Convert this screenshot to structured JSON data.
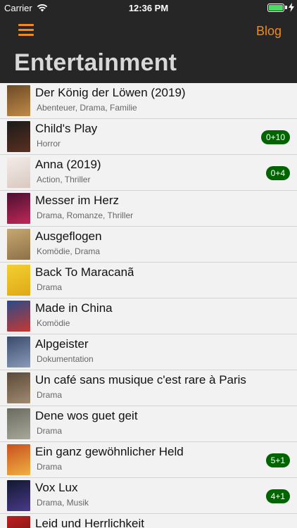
{
  "status": {
    "carrier": "Carrier",
    "time": "12:36 PM"
  },
  "nav": {
    "blog_label": "Blog",
    "title": "Entertainment"
  },
  "movies": [
    {
      "title": "Der König der Löwen (2019)",
      "genres": "Abenteuer, Drama, Familie",
      "badge": "",
      "poster_colors": [
        "#6b4a26",
        "#c08a48"
      ]
    },
    {
      "title": "Child's Play",
      "genres": "Horror",
      "badge": "0+10",
      "poster_colors": [
        "#1a1a1a",
        "#5a3020"
      ]
    },
    {
      "title": "Anna (2019)",
      "genres": "Action, Thriller",
      "badge": "0+4",
      "poster_colors": [
        "#f3ece8",
        "#d9c8c0"
      ]
    },
    {
      "title": "Messer im Herz",
      "genres": "Drama, Romanze, Thriller",
      "badge": "",
      "poster_colors": [
        "#4a1030",
        "#c02858"
      ]
    },
    {
      "title": "Ausgeflogen",
      "genres": "Komödie, Drama",
      "badge": "",
      "poster_colors": [
        "#c8a870",
        "#8c7048"
      ]
    },
    {
      "title": "Back To Maracanã",
      "genres": "Drama",
      "badge": "",
      "poster_colors": [
        "#f2d030",
        "#e0a818"
      ]
    },
    {
      "title": "Made in China",
      "genres": "Komödie",
      "badge": "",
      "poster_colors": [
        "#2a4a8a",
        "#c83830"
      ]
    },
    {
      "title": "Alpgeister",
      "genres": "Dokumentation",
      "badge": "",
      "poster_colors": [
        "#3a4a6a",
        "#8a9ab8"
      ]
    },
    {
      "title": "Un café sans musique c'est rare à Paris",
      "genres": "Drama",
      "badge": "",
      "poster_colors": [
        "#5a4a3a",
        "#a08a70"
      ]
    },
    {
      "title": "Dene wos guet geit",
      "genres": "Drama",
      "badge": "",
      "poster_colors": [
        "#6a6a60",
        "#a8a89a"
      ]
    },
    {
      "title": "Ein ganz gewöhnlicher Held",
      "genres": "Drama",
      "badge": "5+1",
      "poster_colors": [
        "#c85020",
        "#f0b040"
      ]
    },
    {
      "title": "Vox Lux",
      "genres": "Drama, Musik",
      "badge": "4+1",
      "poster_colors": [
        "#101830",
        "#4a3a8a"
      ]
    },
    {
      "title": "Leid und Herrlichkeit",
      "genres": "",
      "badge": "",
      "poster_colors": [
        "#c02020",
        "#601010"
      ]
    }
  ],
  "colors": {
    "accent": "#f08a1d",
    "badge_bg": "#006400",
    "navbar_bg": "#262626"
  }
}
